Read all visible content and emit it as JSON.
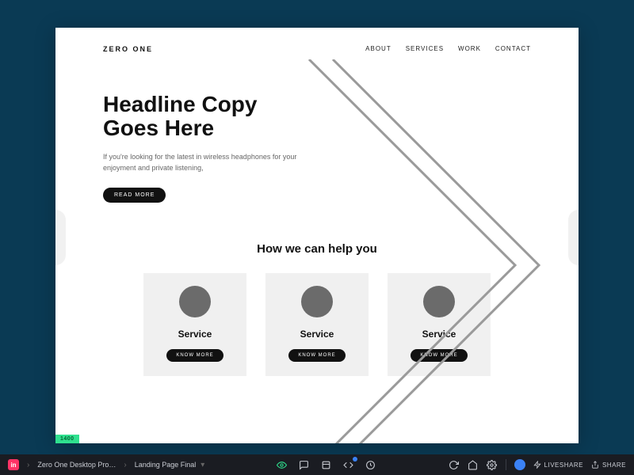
{
  "header": {
    "logo": "ZERO ONE",
    "nav": [
      "ABOUT",
      "SERVICES",
      "WORK",
      "CONTACT"
    ]
  },
  "hero": {
    "headline_l1": "Headline Copy",
    "headline_l2": "Goes Here",
    "sub": "If you're looking for the latest in wireless headphones for your enjoyment and private listening,",
    "cta": "READ MORE"
  },
  "services": {
    "heading": "How we can help you",
    "cards": [
      {
        "title": "Service",
        "cta": "KNOW MORE"
      },
      {
        "title": "Service",
        "cta": "KNOW MORE"
      },
      {
        "title": "Service",
        "cta": "KNOW MORE"
      }
    ]
  },
  "artboard": {
    "width_badge": "1400"
  },
  "toolbar": {
    "invision_glyph": "in",
    "crumb_project": "Zero One Desktop Pro…",
    "crumb_screen": "Landing Page Final",
    "liveshare": "LIVESHARE",
    "share": "SHARE"
  }
}
